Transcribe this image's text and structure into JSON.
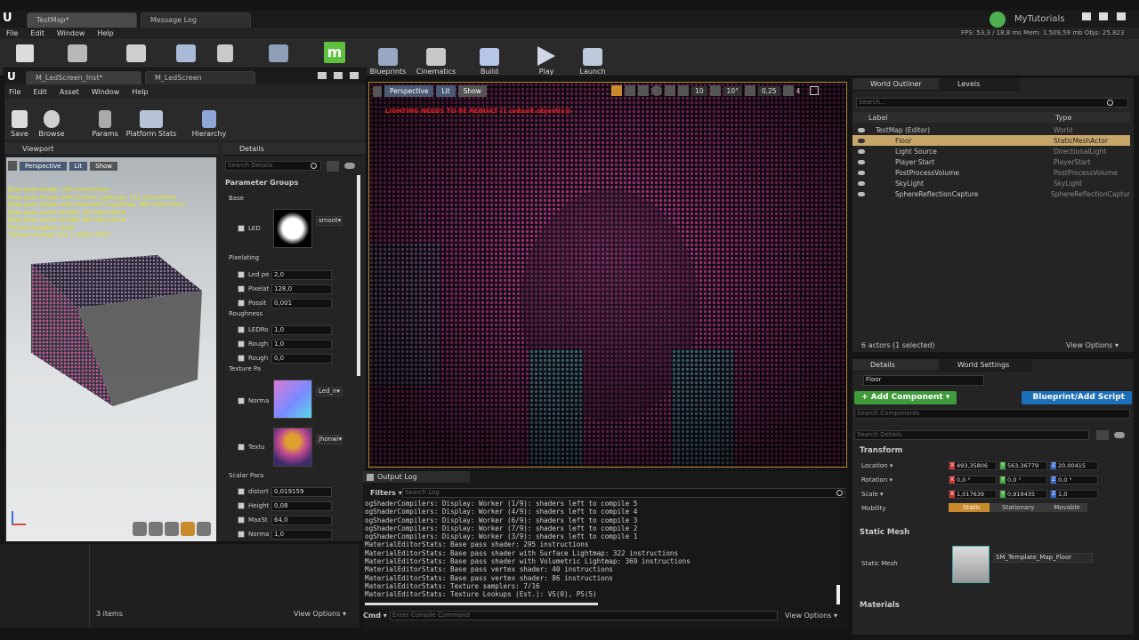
{
  "window": {
    "tabs": [
      "TestMap*",
      "Message Log"
    ],
    "account": "MyTutorials",
    "stats": "FPS: 53,3 / 18,8 ms  Mem: 1.509,59 mb  Objs: 25.823"
  },
  "menu": [
    "File",
    "Edit",
    "Window",
    "Help"
  ],
  "toolbar": {
    "blueprints": "Blueprints",
    "cinematics": "Cinematics",
    "build": "Build",
    "play": "Play",
    "launch": "Launch"
  },
  "material_editor": {
    "tabs": [
      "M_LedScreen_Inst*",
      "M_LedScreen"
    ],
    "menu": [
      "File",
      "Edit",
      "Asset",
      "Window",
      "Help"
    ],
    "toolbar": {
      "save": "Save",
      "browse": "Browse",
      "params": "Params",
      "platform_stats": "Platform Stats",
      "hierarchy": "Hierarchy"
    },
    "viewport_tab": "Viewport",
    "details_tab": "Details",
    "vp_buttons": {
      "perspective": "Perspective",
      "lit": "Lit",
      "show": "Show"
    },
    "stats_lines": [
      "Base pass shader: 295 instructions",
      "Base pass shader with Surface Lightmap: 322 instructions",
      "Base pass shader with Volumetric Lightmap: 369 instructions",
      "Base pass vertex shader: 40 instructions",
      "Base pass vertex shader: 86 instructions",
      "Texture samplers: 8/16",
      "Texture Lookups (Est.): VS(0), PS(5)"
    ],
    "details": {
      "search_placeholder": "Search Details",
      "parameter_groups": "Parameter Groups",
      "base": "Base",
      "led_label": "LED",
      "led_dropdown": "smoot▾",
      "pixelating": "Pixelating",
      "pixelating_params": [
        {
          "label": "Led pe",
          "value": "2,0"
        },
        {
          "label": "Pixelat",
          "value": "128,0"
        },
        {
          "label": "Possit",
          "value": "0,001"
        }
      ],
      "roughness": "Roughness",
      "roughness_params": [
        {
          "label": "LEDRo",
          "value": "1,0"
        },
        {
          "label": "Rough",
          "value": "1,0"
        },
        {
          "label": "Rough",
          "value": "0,0"
        }
      ],
      "texture_params": "Texture Pa",
      "normal_label": "Norma",
      "normal_dropdown": "Led_n▾",
      "texture_label": "Textu",
      "texture_dropdown": "jhonwi▾",
      "scalar_params": "Scalar Para",
      "scalar_list": [
        {
          "label": "distort",
          "value": "0,019159"
        },
        {
          "label": "Height",
          "value": "0,08"
        },
        {
          "label": "MaxSt",
          "value": "64,0"
        },
        {
          "label": "Norma",
          "value": "1,0"
        }
      ]
    }
  },
  "main_viewport": {
    "buttons": {
      "perspective": "Perspective",
      "lit": "Lit",
      "show": "Show"
    },
    "warning": "LIGHTING NEEDS TO BE REBUILT (1 unbuilt object(s))",
    "grid_snap": "10",
    "rot_snap": "10°",
    "scale_snap": "0,25",
    "cam_speed": "4"
  },
  "output_log": {
    "tab": "Output Log",
    "filters": "Filters ▾",
    "search_placeholder": "Search Log",
    "lines": [
      "ogShaderCompilers: Display: Worker (1/9): shaders left to compile 5",
      "ogShaderCompilers: Display: Worker (4/9): shaders left to compile 4",
      "ogShaderCompilers: Display: Worker (6/9): shaders left to compile 3",
      "ogShaderCompilers: Display: Worker (7/9): shaders left to compile 2",
      "ogShaderCompilers: Display: Worker (3/9): shaders left to compile 1",
      "MaterialEditorStats: Base pass shader: 295 instructions",
      "MaterialEditorStats: Base pass shader with Surface Lightmap: 322 instructions",
      "MaterialEditorStats: Base pass shader with Volumetric Lightmap: 369 instructions",
      "MaterialEditorStats: Base pass vertex shader: 40 instructions",
      "MaterialEditorStats: Base pass vertex shader: 86 instructions",
      "MaterialEditorStats: Texture samplers: 7/16",
      "MaterialEditorStats: Texture Lookups (Est.): VS(0), PS(5)"
    ],
    "cmd": "Cmd ▾",
    "console_placeholder": "Enter Console Command",
    "view_options": "View Options ▾"
  },
  "bottom_left": {
    "items": "3 items",
    "view_options": "View Options ▾"
  },
  "outliner": {
    "tabs": [
      "World Outliner",
      "Levels"
    ],
    "search_placeholder": "Search...",
    "col_label": "Label",
    "col_type": "Type",
    "rows": [
      {
        "label": "TestMap (Editor)",
        "type": "World"
      },
      {
        "label": "Floor",
        "type": "StaticMeshActor"
      },
      {
        "label": "Light Source",
        "type": "DirectionalLight"
      },
      {
        "label": "Player Start",
        "type": "PlayerStart"
      },
      {
        "label": "PostProcessVolume",
        "type": "PostProcessVolume"
      },
      {
        "label": "SkyLight",
        "type": "SkyLight"
      },
      {
        "label": "SphereReflectionCapture",
        "type": "SphereReflectionCaptur"
      }
    ],
    "status": "6 actors (1 selected)",
    "view_options": "View Options ▾"
  },
  "details_panel": {
    "tabs": [
      "Details",
      "World Settings"
    ],
    "name": "Floor",
    "add_component": "+ Add Component ▾",
    "blueprint": "Blueprint/Add Script",
    "search_components": "Search Components",
    "search_details": "Search Details",
    "transform": "Transform",
    "location_label": "Location ▾",
    "location": [
      "493,35806",
      "563,36779",
      "20,00415"
    ],
    "rotation_label": "Rotation ▾",
    "rotation": [
      "0,0 °",
      "0,0 °",
      "0,0 °"
    ],
    "scale_label": "Scale ▾",
    "scale": [
      "1,017639",
      "0,919435",
      "1,0"
    ],
    "mobility_label": "Mobility",
    "mobility": [
      "Static",
      "Stationary",
      "Movable"
    ],
    "static_mesh_section": "Static Mesh",
    "static_mesh_label": "Static Mesh",
    "static_mesh_value": "SM_Template_Map_Floor",
    "materials_section": "Materials"
  },
  "colors": {
    "accent_green": "#4caf50",
    "accent_blue": "#1c6fb8",
    "selection": "#c7a66a"
  }
}
